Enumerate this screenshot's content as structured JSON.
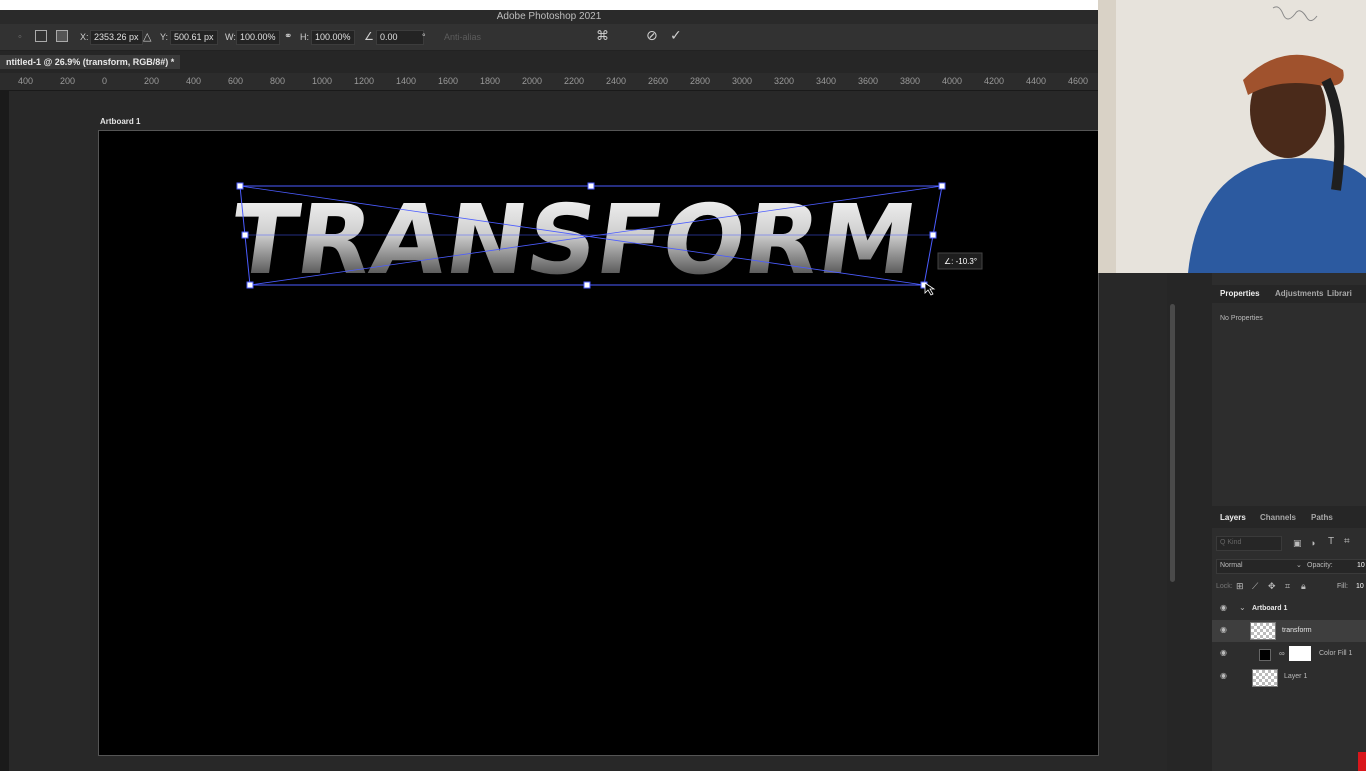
{
  "app": {
    "title": "Adobe Photoshop 2021"
  },
  "options_bar": {
    "x_label": "X:",
    "x_value": "2353.26 px",
    "y_label": "Y:",
    "y_value": "500.61 px",
    "w_label": "W:",
    "w_value": "100.00%",
    "h_label": "H:",
    "h_value": "100.00%",
    "angle_value": "0.00",
    "degree": "°",
    "antialias": "Anti-alias",
    "cancel_icon": "cancel-icon",
    "commit_icon": "checkmark-icon"
  },
  "document": {
    "tab_label": "ntitled-1 @ 26.9% (transform, RGB/8#) *"
  },
  "ruler": {
    "ticks": [
      "400",
      "200",
      "0",
      "200",
      "400",
      "600",
      "800",
      "1000",
      "1200",
      "1400",
      "1600",
      "1800",
      "2000",
      "2200",
      "2400",
      "2600",
      "2800",
      "3000",
      "3200",
      "3400",
      "3600",
      "3800",
      "4000",
      "4200",
      "4400",
      "4600"
    ]
  },
  "canvas": {
    "artboard_label": "Artboard 1",
    "text_layer": "TRANSFORM",
    "skew_readout": "∠: -10.3°"
  },
  "properties_panel": {
    "tabs": [
      "Properties",
      "Adjustments",
      "Librari"
    ],
    "empty_text": "No Properties"
  },
  "layers_panel": {
    "tabs": [
      "Layers",
      "Channels",
      "Paths"
    ],
    "kind_placeholder": "Q Kind",
    "blend_mode": "Normal",
    "opacity_label": "Opacity:",
    "opacity_value": "10",
    "lock_label": "Lock:",
    "fill_label": "Fill:",
    "fill_value": "10",
    "layers": [
      {
        "name": "Artboard 1",
        "type": "artboard"
      },
      {
        "name": "transform",
        "type": "smart-object",
        "selected": true
      },
      {
        "name": "Color Fill 1",
        "type": "fill"
      },
      {
        "name": "Layer 1",
        "type": "pixel"
      }
    ]
  },
  "colors": {
    "accent": "#4b5cff",
    "artboard": "#000000",
    "panel": "#2d2d2d"
  }
}
